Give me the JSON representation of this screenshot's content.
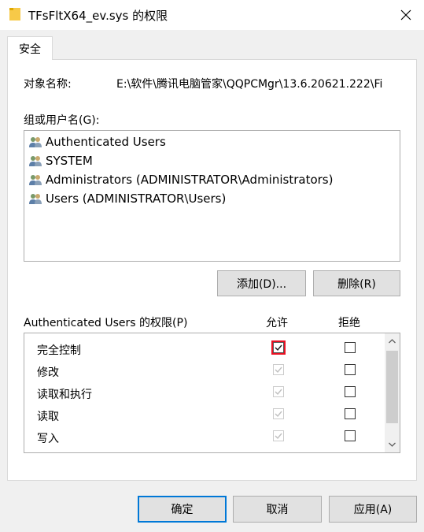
{
  "window": {
    "title": "TFsFltX64_ev.sys 的权限",
    "close_icon": "close-icon"
  },
  "tabs": [
    {
      "label": "安全"
    }
  ],
  "object": {
    "label": "对象名称:",
    "value": "E:\\软件\\腾讯电脑管家\\QQPCMgr\\13.6.20621.222\\Fi"
  },
  "groups": {
    "label": "组或用户名(G):",
    "items": [
      {
        "label": "Authenticated Users",
        "icon": "users-icon"
      },
      {
        "label": "SYSTEM",
        "icon": "users-icon"
      },
      {
        "label": "Administrators (ADMINISTRATOR\\Administrators)",
        "icon": "users-icon"
      },
      {
        "label": "Users (ADMINISTRATOR\\Users)",
        "icon": "users-icon"
      }
    ],
    "add_label": "添加(D)...",
    "remove_label": "删除(R)"
  },
  "permissions": {
    "label": "Authenticated Users 的权限(P)",
    "allow_header": "允许",
    "deny_header": "拒绝",
    "rows": [
      {
        "name": "完全控制",
        "allow": true,
        "allow_enabled": true,
        "deny": false
      },
      {
        "name": "修改",
        "allow": true,
        "allow_enabled": false,
        "deny": false
      },
      {
        "name": "读取和执行",
        "allow": true,
        "allow_enabled": false,
        "deny": false
      },
      {
        "name": "读取",
        "allow": true,
        "allow_enabled": false,
        "deny": false
      },
      {
        "name": "写入",
        "allow": true,
        "allow_enabled": false,
        "deny": false
      }
    ]
  },
  "footer": {
    "ok_label": "确定",
    "cancel_label": "取消",
    "apply_label": "应用(A)"
  },
  "colors": {
    "accent": "#0078d7",
    "focus_outline": "#e81123",
    "check_enabled": "#1a1a1a",
    "check_disabled": "#bfbfbf"
  }
}
